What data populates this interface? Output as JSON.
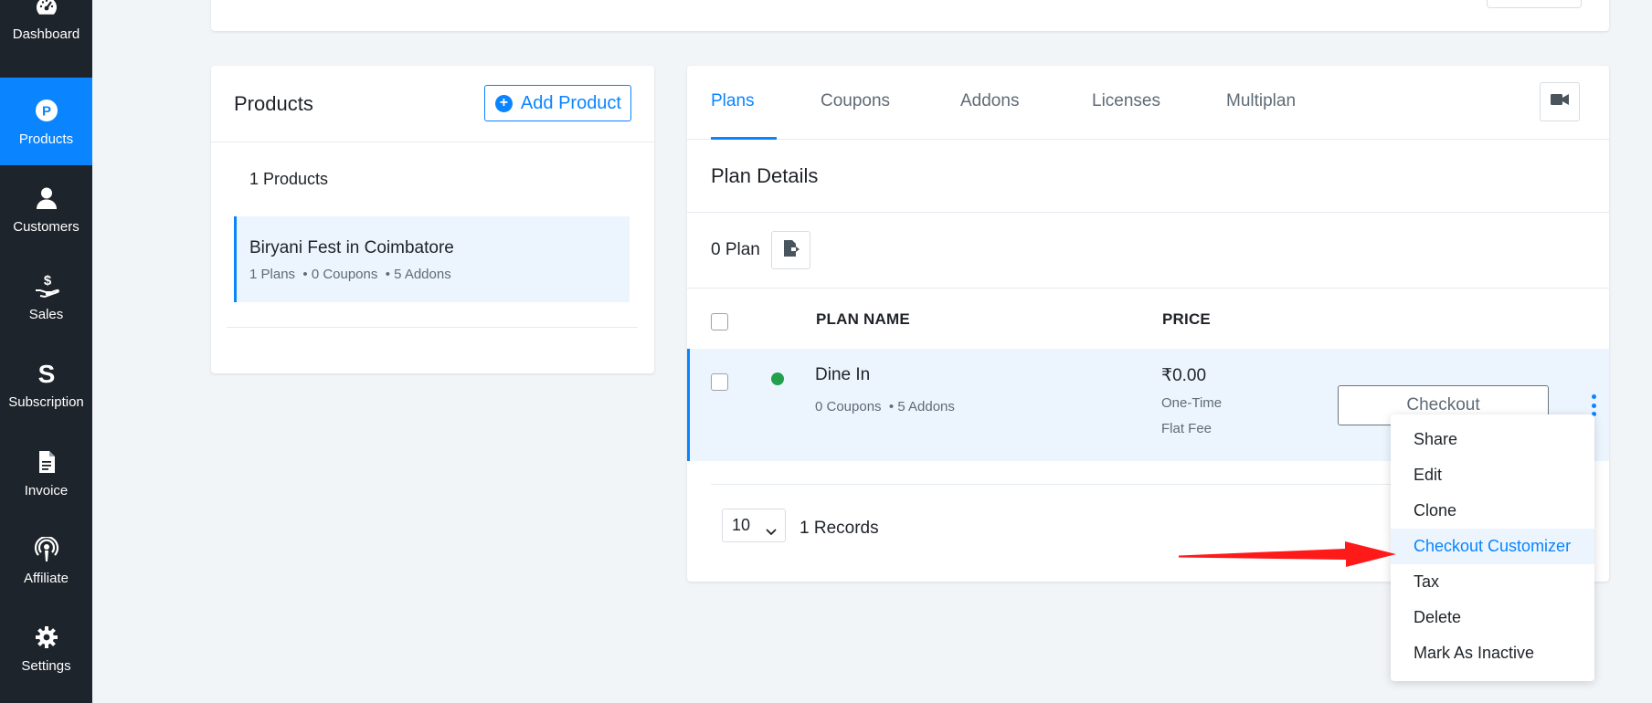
{
  "sidebar": {
    "items": [
      {
        "label": "Dashboard",
        "icon": "gauge-icon"
      },
      {
        "label": "Products",
        "icon": "p-circle-icon",
        "active": true
      },
      {
        "label": "Customers",
        "icon": "user-icon"
      },
      {
        "label": "Sales",
        "icon": "hand-dollar-icon"
      },
      {
        "label": "Subscription",
        "icon": "s-letter-icon"
      },
      {
        "label": "Invoice",
        "icon": "document-icon"
      },
      {
        "label": "Affiliate",
        "icon": "broadcast-icon"
      },
      {
        "label": "Settings",
        "icon": "gear-icon"
      }
    ]
  },
  "products": {
    "title": "Products",
    "add_button": "Add Product",
    "count_label": "1 Products",
    "items": [
      {
        "name": "Biryani Fest in Coimbatore",
        "plans": "1 Plans",
        "coupons": "0 Coupons",
        "addons": "5 Addons"
      }
    ]
  },
  "plans_panel": {
    "tabs": [
      "Plans",
      "Coupons",
      "Addons",
      "Licenses",
      "Multiplan"
    ],
    "active_tab": "Plans",
    "section_title": "Plan Details",
    "plan_count": "0 Plan",
    "columns": {
      "name": "PLAN NAME",
      "price": "PRICE"
    },
    "rows": [
      {
        "name": "Dine In",
        "coupons": "0 Coupons",
        "addons": "5 Addons",
        "price": "₹0.00",
        "billing": "One-Time",
        "fee": "Flat Fee",
        "status": "active",
        "action": "Checkout"
      }
    ],
    "page_size": "10",
    "records": "1 Records"
  },
  "menu": {
    "items": [
      "Share",
      "Edit",
      "Clone",
      "Checkout Customizer",
      "Tax",
      "Delete",
      "Mark As Inactive"
    ],
    "highlighted": "Checkout Customizer"
  },
  "colors": {
    "accent": "#0a84ff",
    "sidebar_bg": "#1e242b",
    "status_active": "#22a04b",
    "annotation": "#ff1a1a"
  }
}
